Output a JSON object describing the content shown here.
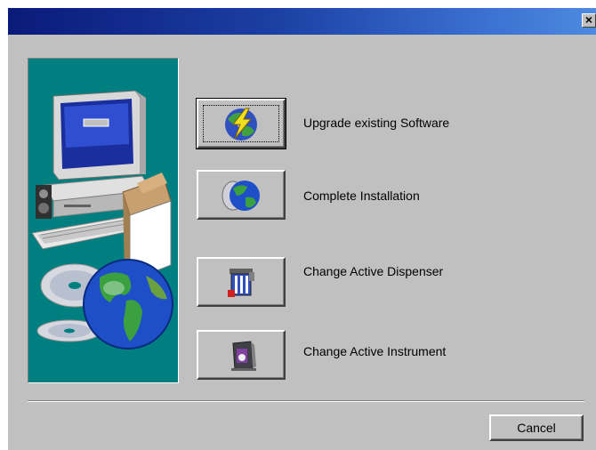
{
  "window": {
    "title": "",
    "close_label": "×"
  },
  "options": [
    {
      "label": "Upgrade existing Software",
      "icon": "upgrade-disc-icon"
    },
    {
      "label": "Complete Installation",
      "icon": "globe-disc-icon"
    },
    {
      "label": "Change Active Dispenser",
      "icon": "dispenser-icon"
    },
    {
      "label": "Change Active Instrument",
      "icon": "instrument-icon"
    }
  ],
  "footer": {
    "cancel_label": "Cancel"
  },
  "colors": {
    "titlebar_start": "#0a1a7a",
    "titlebar_end": "#4d8ae0",
    "dialog_face": "#c0c0c0",
    "side_panel": "#007f80"
  }
}
